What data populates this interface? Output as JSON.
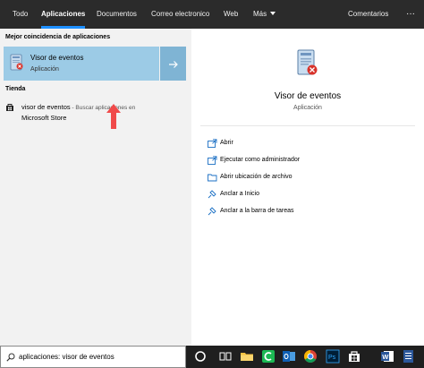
{
  "tabs": [
    "Todo",
    "Aplicaciones",
    "Documentos",
    "Correo electronico",
    "Web",
    "Más"
  ],
  "tabs_right": "Comentarios",
  "more_dots": "···",
  "left": {
    "best_match_header": "Mejor coincidencia de aplicaciones",
    "best_match": {
      "name": "Visor de eventos",
      "type": "Aplicación"
    },
    "store_header": "Tienda",
    "store_item": {
      "name": "visor de eventos",
      "suffix": " - Buscar aplicaciones en",
      "line2": "Microsoft Store"
    }
  },
  "right": {
    "title": "Visor de eventos",
    "subtitle": "Aplicación",
    "actions": [
      "Abrir",
      "Ejecutar como administrador",
      "Abrir ubicación de archivo",
      "Anclar a Inicio",
      "Anclar a la barra de tareas"
    ]
  },
  "taskbar": {
    "search_value": "aplicaciones: visor de eventos",
    "icons": [
      "cortana-circle-icon",
      "task-view-icon",
      "file-explorer-icon",
      "camtasia-icon",
      "outlook-icon",
      "chrome-icon",
      "word-icon",
      "photoshop-icon",
      "store-icon",
      "word-doc-icon"
    ]
  },
  "colors": {
    "topbar_bg": "#2b2b2b",
    "active_underline": "#1e90ff",
    "left_bg": "#f2f2f2",
    "selected_bg": "#9ccbe6",
    "accent_icon": "#1a6fc4",
    "annotation_arrow": "#f04a4a"
  }
}
